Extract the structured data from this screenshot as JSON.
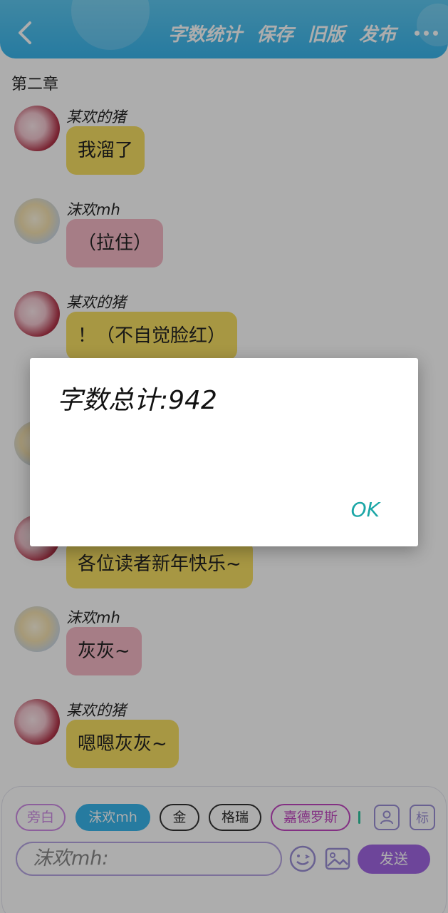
{
  "header": {
    "actions": [
      "字数统计",
      "保存",
      "旧版",
      "发布"
    ],
    "bg_color": "#39b5ec"
  },
  "chapter_title": "第二章",
  "messages": [
    {
      "sender": "某欢的猪",
      "text": "我溜了",
      "bubble": "yellow",
      "avatar": "pig"
    },
    {
      "sender": "沫欢mh",
      "text": "（拉住）",
      "bubble": "pink",
      "avatar": "mh"
    },
    {
      "sender": "某欢的猪",
      "text": "！（不自觉脸红）",
      "bubble": "yellow",
      "avatar": "pig"
    },
    {
      "sender": "",
      "text": "",
      "bubble": "pink",
      "avatar": "mh"
    },
    {
      "sender": "",
      "text": "各位读者新年快乐~",
      "bubble": "yellow",
      "avatar": "pig"
    },
    {
      "sender": "沫欢mh",
      "text": "灰灰~",
      "bubble": "pink",
      "avatar": "mh"
    },
    {
      "sender": "某欢的猪",
      "text": "嗯嗯灰灰~",
      "bubble": "yellow",
      "avatar": "pig"
    }
  ],
  "roles": [
    "旁白",
    "沫欢mh",
    "金",
    "格瑞",
    "嘉德罗斯"
  ],
  "composer": {
    "input_value": "沫欢mh:",
    "send_label": "发送",
    "tag_label": "标"
  },
  "dialog": {
    "message": "字数总计:942",
    "ok_label": "OK"
  },
  "colors": {
    "accent": "#39b5ec",
    "yellow_bubble": "#f7df63",
    "pink_bubble": "#f5b9c6",
    "send": "#a166e3",
    "ok_text": "#1aa6a6"
  }
}
